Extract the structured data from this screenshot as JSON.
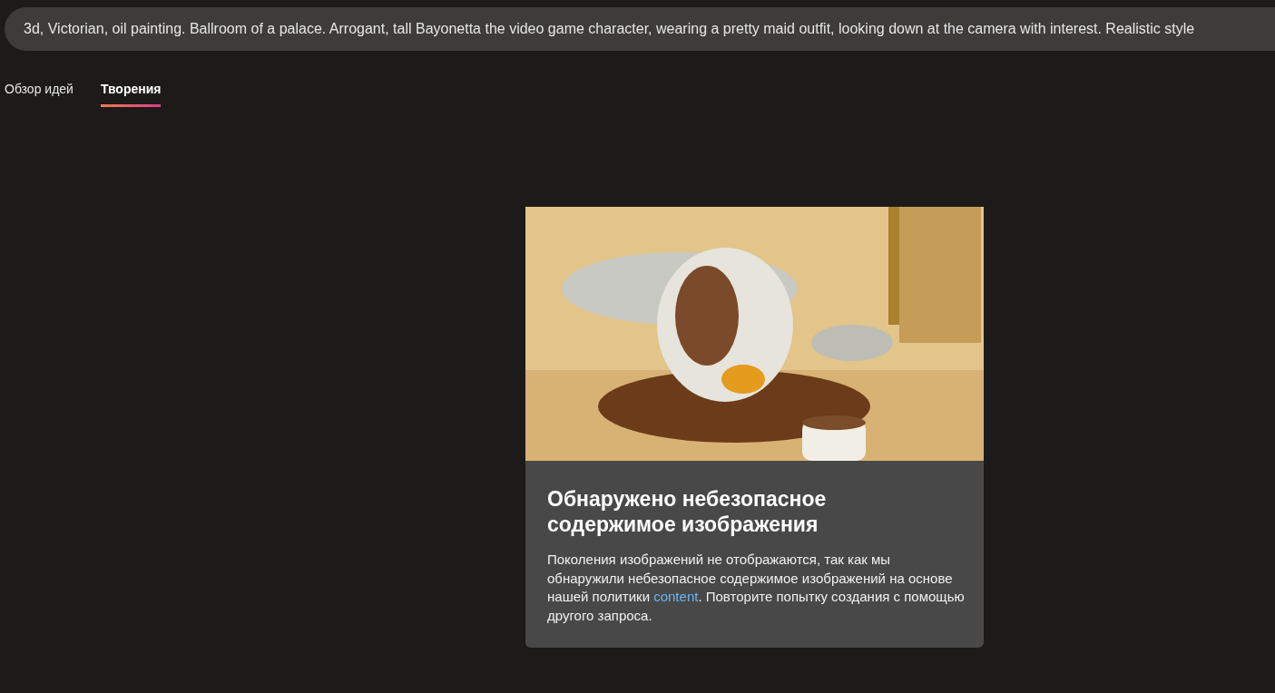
{
  "prompt": {
    "value": "3d, Victorian, oil painting. Ballroom of a palace. Arrogant, tall Bayonetta the video game character, wearing a pretty maid outfit, looking down at the camera with interest. Realistic style"
  },
  "tabs": [
    {
      "label": "Обзор идей",
      "selected": false
    },
    {
      "label": "Творения",
      "selected": true
    }
  ],
  "card": {
    "title": "Обнаружено небезопасное содержимое изображения",
    "message": {
      "before": "Поколения изображений не отображаются, так как мы обнаружили небезопасное содержимое изображений на основе нашей политики ",
      "link": "content",
      "after": ". Повторите попытку создания с помощью другого запроса."
    }
  }
}
